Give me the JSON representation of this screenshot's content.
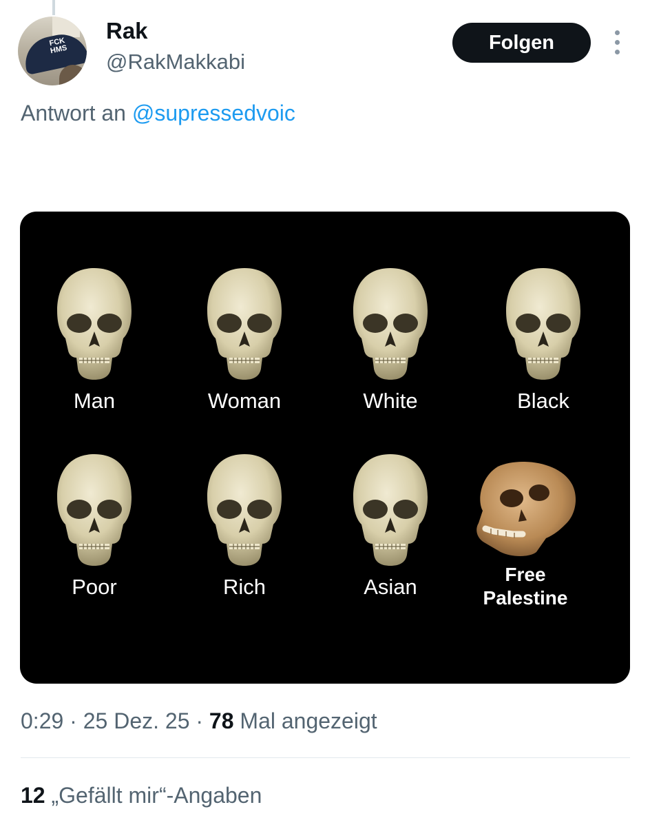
{
  "author": {
    "name": "Rak",
    "handle": "@RakMakkabi",
    "avatar_text": "FCK\nHMS"
  },
  "actions": {
    "follow_label": "Folgen",
    "more_icon": "more-vertical-icon"
  },
  "reply": {
    "prefix": "Antwort an",
    "mention": "@supressedvoic"
  },
  "media": {
    "labels": [
      "Man",
      "Woman",
      "White",
      "Black",
      "Poor",
      "Rich",
      "Asian",
      "Free\nPalestine"
    ]
  },
  "meta": {
    "time": "0:29",
    "sep1": "·",
    "date": "25 Dez. 25",
    "sep2": "·",
    "views_count": "78",
    "views_label": "Mal angezeigt"
  },
  "likes": {
    "count": "12",
    "label": "„Gefällt mir“-Angaben"
  },
  "colors": {
    "accent": "#1d9bf0",
    "text": "#0f1419",
    "secondary": "#536471",
    "button_bg": "#0f1419"
  }
}
